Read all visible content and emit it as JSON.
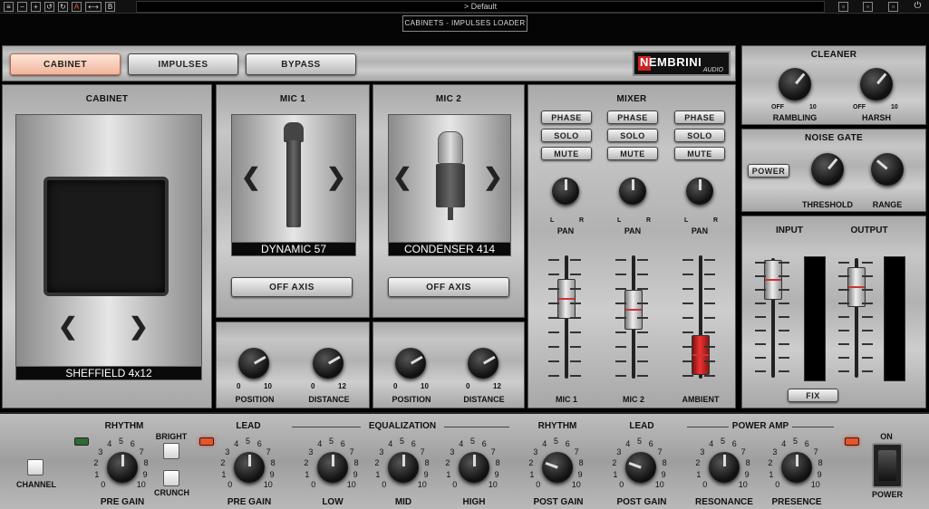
{
  "topbar": {
    "preset": "> Default",
    "title": "CABINETS - IMPULSES LOADER"
  },
  "tabs": [
    {
      "label": "CABINET",
      "active": true
    },
    {
      "label": "IMPULSES",
      "active": false
    },
    {
      "label": "BYPASS",
      "active": false
    }
  ],
  "logo": {
    "brand": "NEMBRINI",
    "sub": "AUDIO"
  },
  "cabinet": {
    "title": "CABINET",
    "name": "SHEFFIELD 4x12"
  },
  "mic1": {
    "title": "MIC 1",
    "name": "DYNAMIC 57",
    "axis_label": "OFF AXIS",
    "position_label": "POSITION",
    "distance_label": "DISTANCE",
    "position_range": [
      "0",
      "10"
    ],
    "distance_range": [
      "0",
      "12"
    ]
  },
  "mic2": {
    "title": "MIC 2",
    "name": "CONDENSER 414",
    "axis_label": "OFF AXIS",
    "position_label": "POSITION",
    "distance_label": "DISTANCE",
    "position_range": [
      "0",
      "10"
    ],
    "distance_range": [
      "0",
      "12"
    ]
  },
  "mixer": {
    "title": "MIXER",
    "phase": "PHASE",
    "solo": "SOLO",
    "mute": "MUTE",
    "pan": "PAN",
    "l": "L",
    "r": "R",
    "channels": [
      "MIC 1",
      "MIC 2",
      "AMBIENT"
    ]
  },
  "cleaner": {
    "title": "CLEANER",
    "rambling": "RAMBLING",
    "harsh": "HARSH",
    "off": "OFF",
    "ten": "10"
  },
  "noise_gate": {
    "title": "NOISE GATE",
    "power": "POWER",
    "threshold": "THRESHOLD",
    "range": "RANGE"
  },
  "io": {
    "input": "INPUT",
    "output": "OUTPUT",
    "fix": "FIX"
  },
  "amp": {
    "channel": "CHANNEL",
    "rhythm": "RHYTHM",
    "lead": "LEAD",
    "bright": "BRIGHT",
    "crunch": "CRUNCH",
    "pre_gain": "PRE GAIN",
    "equalization": "EQUALIZATION",
    "low": "LOW",
    "mid": "MID",
    "high": "HIGH",
    "post_gain": "POST GAIN",
    "power_amp": "POWER AMP",
    "resonance": "RESONANCE",
    "presence": "PRESENCE",
    "on": "ON",
    "power": "POWER",
    "scale": [
      "0",
      "1",
      "2",
      "3",
      "4",
      "5",
      "6",
      "7",
      "8",
      "9",
      "10"
    ]
  },
  "colors": {
    "led_green": "#2f6a2f",
    "led_red": "#e8532a",
    "active_tab": "#f0b49a"
  }
}
